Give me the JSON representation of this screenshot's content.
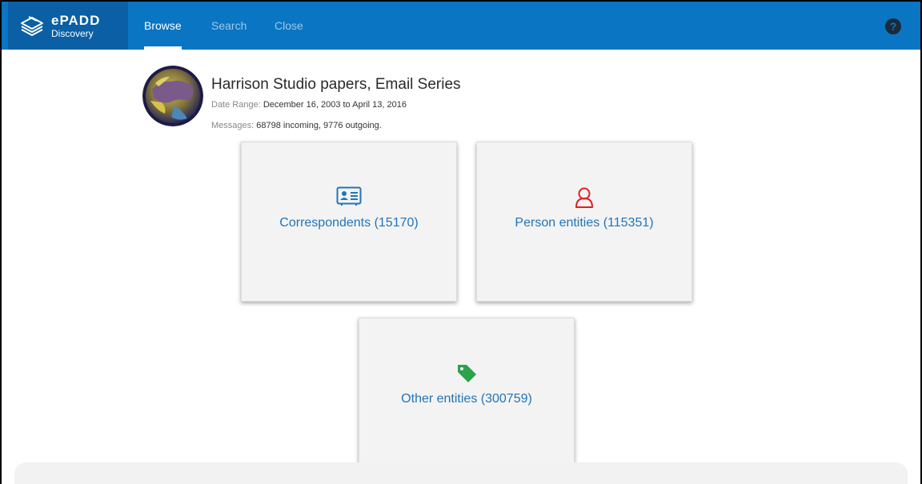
{
  "app": {
    "brand_name": "ePADD",
    "brand_sub": "Discovery",
    "accent_color": "#0a75c2"
  },
  "nav": {
    "tabs": [
      {
        "label": "Browse",
        "active": true
      },
      {
        "label": "Search",
        "active": false
      },
      {
        "label": "Close",
        "active": false
      }
    ],
    "help_icon": "question-circle-icon",
    "help_glyph": "?"
  },
  "collection": {
    "title": "Harrison Studio papers, Email Series",
    "date_range_label": "Date Range:",
    "date_range_value": "December 16, 2003 to April 13, 2016",
    "messages_label": "Messages:",
    "messages_value": "68798 incoming, 9776 outgoing."
  },
  "cards": [
    {
      "label": "Correspondents (15170)",
      "icon": "contact-card-icon"
    },
    {
      "label": "Person entities (115351)",
      "icon": "person-outline-icon"
    },
    {
      "label": "Other entities (300759)",
      "icon": "tag-icon"
    }
  ]
}
